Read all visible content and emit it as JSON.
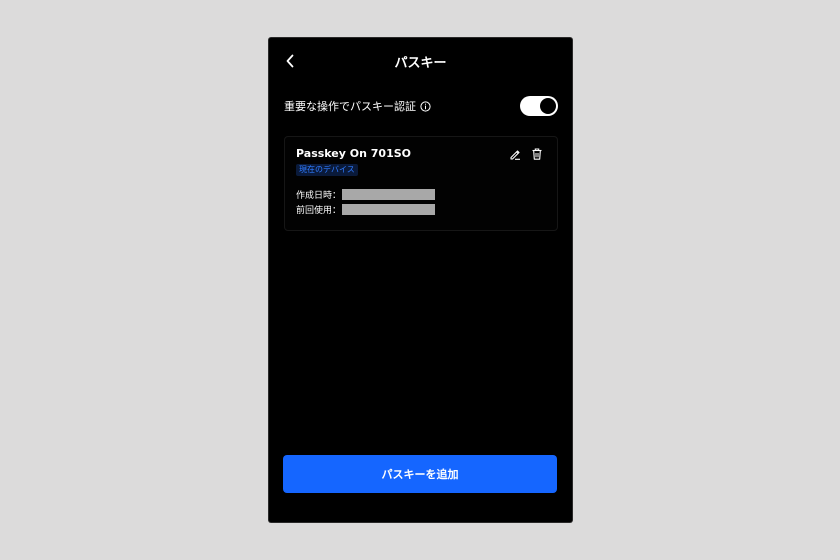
{
  "header": {
    "title": "パスキー",
    "back_icon": "chevron-left-icon"
  },
  "setting": {
    "label": "重要な操作でパスキー認証",
    "info_icon": "info-icon",
    "toggle_on": true
  },
  "passkey": {
    "name": "Passkey On 701SO",
    "badge": "現在のデバイス",
    "created_label": "作成日時：",
    "last_used_label": "前回使用：",
    "edit_icon": "pencil-icon",
    "delete_icon": "trash-icon"
  },
  "actions": {
    "add_label": "パスキーを追加"
  },
  "colors": {
    "background": "#000000",
    "accent": "#1566ff",
    "badge_text": "#2f7bff",
    "page_backdrop": "#dcdbdb"
  }
}
